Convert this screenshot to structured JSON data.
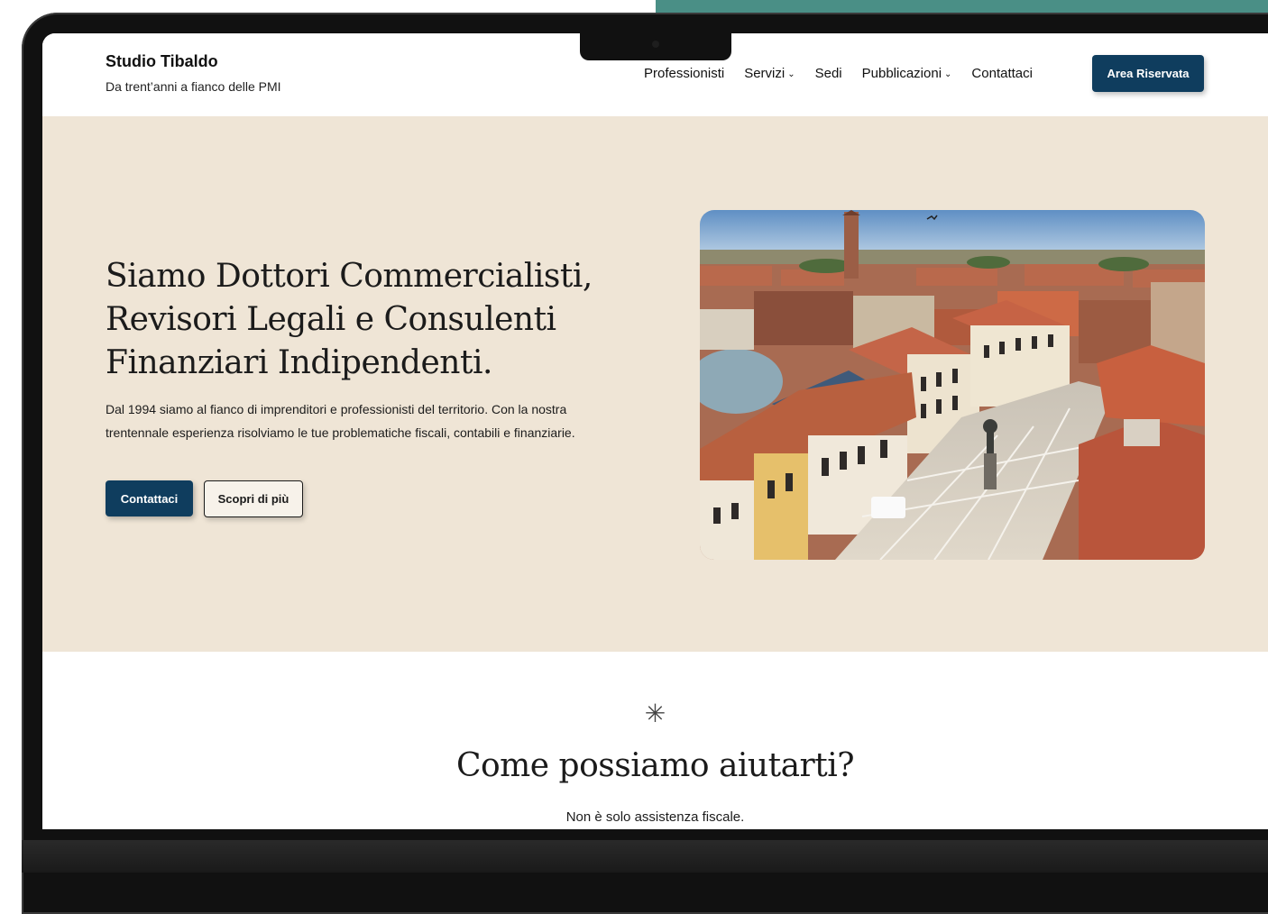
{
  "brand": {
    "name": "Studio Tibaldo",
    "tagline": "Da trent’anni a fianco delle PMI"
  },
  "nav": {
    "items": [
      {
        "label": "Professionisti",
        "has_dropdown": false
      },
      {
        "label": "Servizi",
        "has_dropdown": true
      },
      {
        "label": "Sedi",
        "has_dropdown": false
      },
      {
        "label": "Pubblicazioni",
        "has_dropdown": true
      },
      {
        "label": "Contattaci",
        "has_dropdown": false
      }
    ],
    "cta_label": "Area Riservata",
    "chevron_icon": "chevron-down-icon"
  },
  "hero": {
    "title": "Siamo Dottori Commercialisti, Revisori Legali e Consulenti Finanziari Indipendenti.",
    "description": "Dal 1994 siamo al fianco di imprenditori e professionisti del territorio. Con la nostra trentennale esperienza risolviamo le tue problematiche fiscali, contabili e finanziarie.",
    "primary_button": "Contattaci",
    "secondary_button": "Scopri di più",
    "image_icon": "town-square-photo"
  },
  "services": {
    "icon": "asterisk-icon",
    "title": "Come possiamo aiutarti?",
    "subtitle": "Non è solo assistenza fiscale."
  },
  "colors": {
    "primary": "#0f3d5e",
    "hero_background": "#efe5d6",
    "accent_teal": "#4a8f86"
  }
}
